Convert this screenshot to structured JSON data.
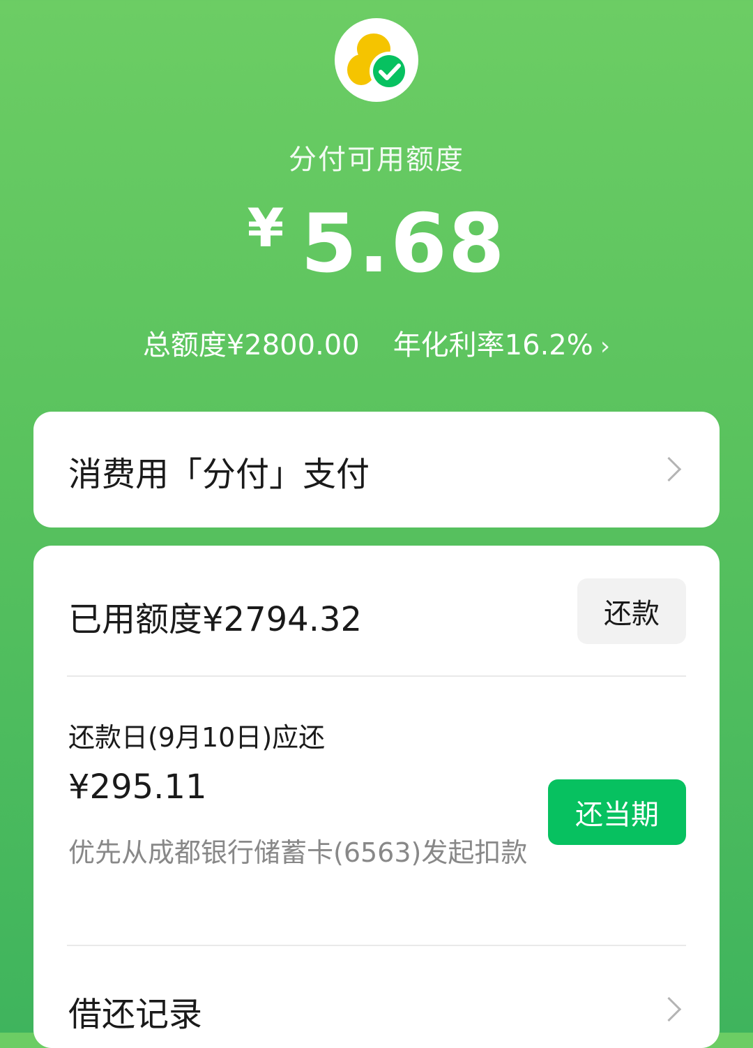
{
  "header": {
    "logo_icon": "fenfu-logo-icon",
    "label": "分付可用额度",
    "currency": "¥",
    "available_amount": "5.68",
    "total_limit": "总额度¥2800.00",
    "annual_rate": "年化利率16.2%"
  },
  "pay_card": {
    "title": "消费用「分付」支付"
  },
  "main_card": {
    "used_limit": "已用额度¥2794.32",
    "repay_button": "还款",
    "due_label": "还款日(9月10日)应还",
    "due_amount": "¥295.11",
    "due_note": "优先从成都银行储蓄卡(6563)发起扣款",
    "repay_current_button": "还当期",
    "records_label": "借还记录"
  },
  "colors": {
    "brand_green": "#07c160",
    "bg_green_top": "#6ccd64",
    "bg_green_bottom": "#3fb45d",
    "logo_yellow": "#f5c400"
  }
}
